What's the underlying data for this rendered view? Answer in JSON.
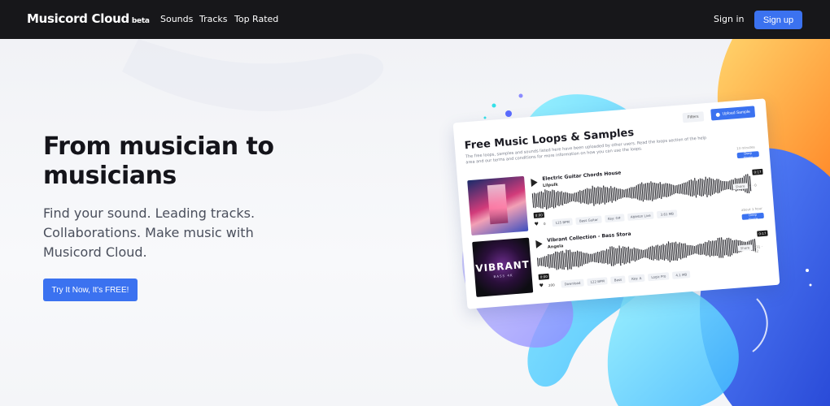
{
  "nav": {
    "brand": "Musicord Cloud",
    "beta": "beta",
    "links": [
      "Sounds",
      "Tracks",
      "Top Rated"
    ],
    "signin": "Sign in",
    "signup": "Sign up"
  },
  "hero": {
    "title": "From musician to musicians",
    "subtitle": "Find your sound. Leading tracks. Collaborations. Make music with Musicord Cloud.",
    "cta": "Try It Now, It's FREE!"
  },
  "card": {
    "title": "Free Music Loops & Samples",
    "description": "The free loops, samples and sounds listed here have been uploaded by other users. Read the loops section of the help area and our terms and conditions for more information on how you can use the loops.",
    "filters": "Filters",
    "upload": "Upload Sample",
    "tracks": [
      {
        "title": "Electric Guitar Chords House",
        "artist": "Lilpulk",
        "time": "0:00",
        "end": "0:17",
        "likes": "0",
        "tags": [
          "125 BPM",
          "Bass Guitar",
          "Key: G#",
          "Ableton Live",
          "3.61 MB"
        ],
        "share": "Share",
        "stats": "9 · 0",
        "minutes": "13 minutes",
        "deep": "Deep House"
      },
      {
        "title": "Vibrant Collection - Bass Stora",
        "artist": "Angela",
        "time": "0:00",
        "end": "0:17",
        "likes": "200",
        "tags": [
          "Download",
          "122 BPM",
          "Bass",
          "Key: A",
          "Logic Pro",
          "4.1 MB"
        ],
        "share": "Share",
        "stats": "231 · 12",
        "minutes": "about 1 hour",
        "deep": "Deep House",
        "cover_title": "VIBRANT",
        "cover_sub": "BASS 4K"
      }
    ]
  },
  "colors": {
    "accent": "#3b72f0",
    "navbar": "#17171a"
  }
}
